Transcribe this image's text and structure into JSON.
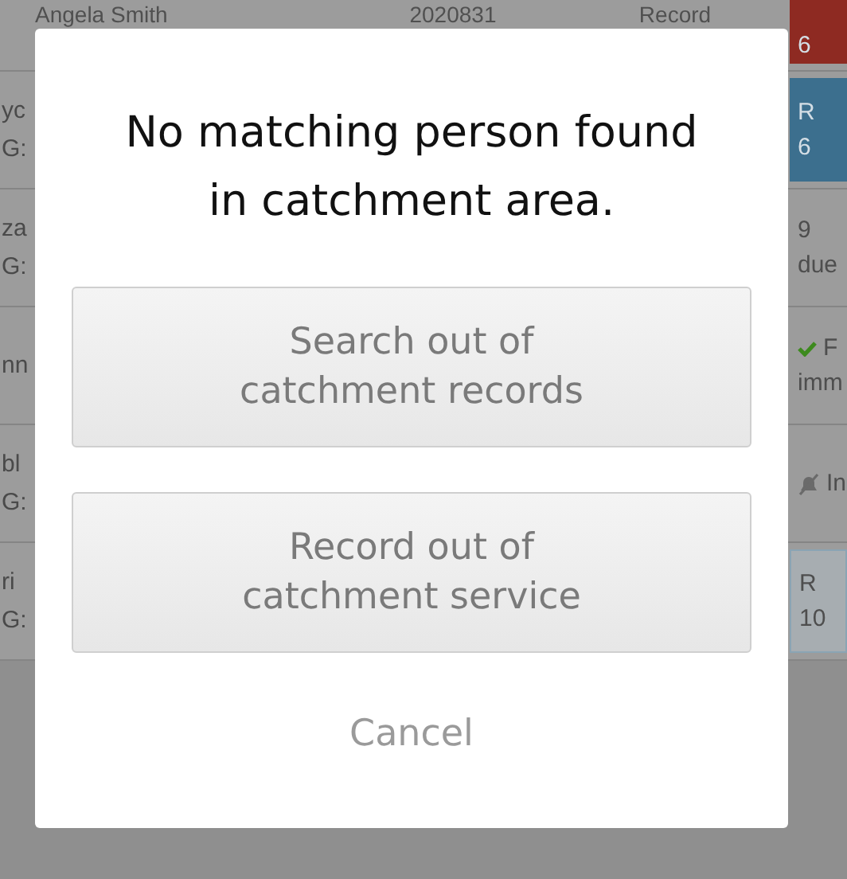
{
  "background": {
    "top_row": {
      "name": "Angela Smith",
      "number": "2020831",
      "action": "Record",
      "status": {
        "kind": "filled",
        "color": "#8e2a22",
        "lines": [
          "6"
        ]
      }
    },
    "rows": [
      {
        "name": "yc",
        "sub": "G:",
        "status": {
          "kind": "filled",
          "color": "#3c6f8e",
          "lines": [
            "R",
            "6"
          ]
        }
      },
      {
        "name": "za",
        "sub": "G:",
        "status": {
          "kind": "plain",
          "lines": [
            "9",
            "due"
          ]
        }
      },
      {
        "name": "nn",
        "status": {
          "kind": "check",
          "lines": [
            "F",
            "imm"
          ]
        }
      },
      {
        "name": "bl",
        "sub": "G:",
        "status": {
          "kind": "muted_bell",
          "lines": [
            "In"
          ]
        }
      },
      {
        "name": "ri",
        "sub": "G:",
        "status": {
          "kind": "outlined",
          "color": "#8aa4b4",
          "lines": [
            "R",
            "10"
          ]
        }
      }
    ]
  },
  "dialog": {
    "title": "No matching person found in catchment area.",
    "buttons": [
      "Search out of catchment records",
      "Record out of catchment service"
    ],
    "cancel": "Cancel"
  }
}
